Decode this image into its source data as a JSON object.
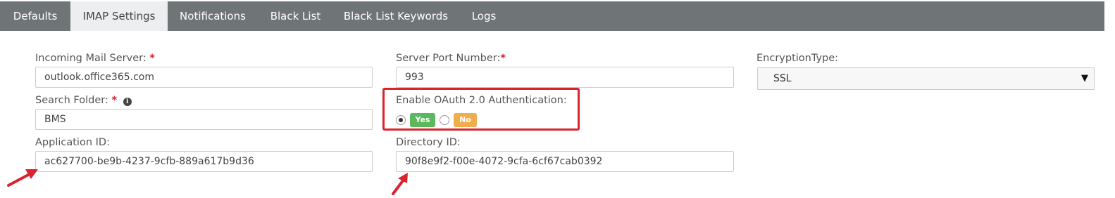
{
  "tabs": [
    {
      "label": "Defaults",
      "active": false
    },
    {
      "label": "IMAP Settings",
      "active": true
    },
    {
      "label": "Notifications",
      "active": false
    },
    {
      "label": "Black List",
      "active": false
    },
    {
      "label": "Black List Keywords",
      "active": false
    },
    {
      "label": "Logs",
      "active": false
    }
  ],
  "form": {
    "incoming_server": {
      "label": "Incoming Mail Server:",
      "required_mark": "*",
      "value": "outlook.office365.com"
    },
    "server_port": {
      "label": "Server Port Number:",
      "required_mark": "*",
      "value": "993"
    },
    "encryption": {
      "label": "EncryptionType:",
      "selected": "SSL"
    },
    "search_folder": {
      "label": "Search Folder:",
      "required_mark": "*",
      "info_icon": "info-icon",
      "value": "BMS"
    },
    "oauth": {
      "label": "Enable OAuth 2.0 Authentication:",
      "yes_label": "Yes",
      "no_label": "No",
      "selected": "Yes"
    },
    "application_id": {
      "label": "Application ID:",
      "value": "ac627700-be9b-4237-9cfb-889a617b9d36"
    },
    "directory_id": {
      "label": "Directory ID:",
      "value": "90f8e9f2-f00e-4072-9cfa-6cf67cab0392"
    }
  },
  "colors": {
    "tab_bar": "#6f7577",
    "active_tab": "#eceeef",
    "required": "#d9232e",
    "yes_pill": "#5cb85c",
    "no_pill": "#f0ad4e",
    "annotation": "#d9232e"
  },
  "annotations": {
    "highlight_box": "red rectangle around OAuth option",
    "arrows": [
      "arrow-to-application-id",
      "arrow-to-directory-id"
    ]
  }
}
